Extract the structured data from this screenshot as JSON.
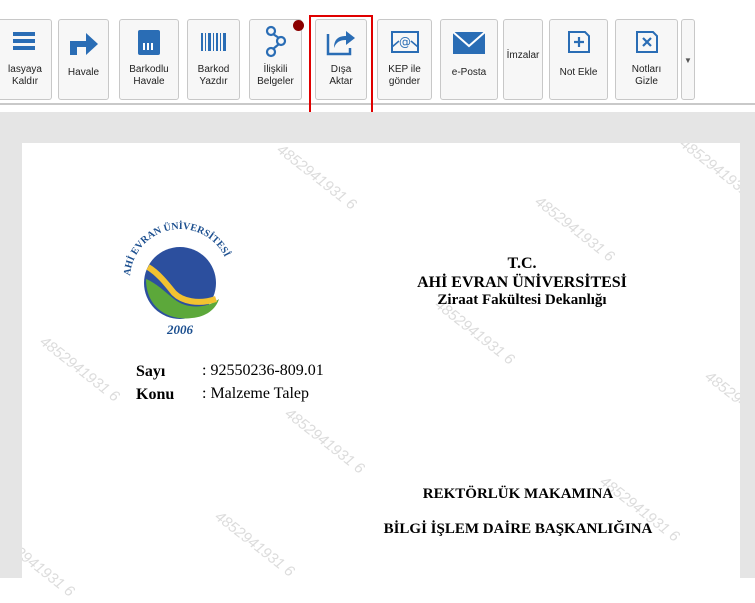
{
  "toolbar": {
    "buttons": [
      {
        "id": "klasoreKaldir",
        "label": "lasyaya\nKaldır",
        "icon": "list-icon"
      },
      {
        "id": "havale",
        "label": "Havale",
        "icon": "arrow-right-icon"
      },
      {
        "id": "barkodluHavale",
        "label": "Barkodlu\nHavale",
        "icon": "sim-card-icon"
      },
      {
        "id": "barkodYazdir",
        "label": "Barkod\nYazdır",
        "icon": "barcode-icon"
      },
      {
        "id": "iliskiliBelgeler",
        "label": "İlişkili\nBelgeler",
        "icon": "link-nodes-icon"
      },
      {
        "id": "disaAktar",
        "label": "Dışa\nAktar",
        "icon": "export-icon"
      },
      {
        "id": "kepIleGonder",
        "label": "KEP ile\ngönder",
        "icon": "at-mail-icon"
      },
      {
        "id": "ePosta",
        "label": "e-Posta",
        "icon": "envelope-icon"
      },
      {
        "id": "imzalar",
        "label": "İmzalar",
        "icon": "none"
      },
      {
        "id": "notEkle",
        "label": "Not Ekle",
        "icon": "note-add-icon"
      },
      {
        "id": "notlariGizle",
        "label": "Notları\nGizle",
        "icon": "note-hide-icon"
      }
    ],
    "accent_color": "#2a6db5",
    "highlight_color": "#e00000",
    "badge_color": "#8b0000"
  },
  "document": {
    "watermark": "4852941931 6",
    "logo": {
      "arc_text": "AHİ EVRAN ÜNİVERSİTESİ",
      "year": "2006"
    },
    "header": {
      "line1": "T.C.",
      "line2": "AHİ EVRAN ÜNİVERSİTESİ",
      "line3": "Ziraat Fakültesi Dekanlığı"
    },
    "meta": {
      "sayi_label": "Sayı",
      "sayi_value": ": 92550236-809.01",
      "konu_label": "Konu",
      "konu_value": ": Malzeme Talep"
    },
    "address": {
      "line1": "REKTÖRLÜK MAKAMINA",
      "line2": "BİLGİ İŞLEM DAİRE BAŞKANLIĞINA"
    }
  }
}
